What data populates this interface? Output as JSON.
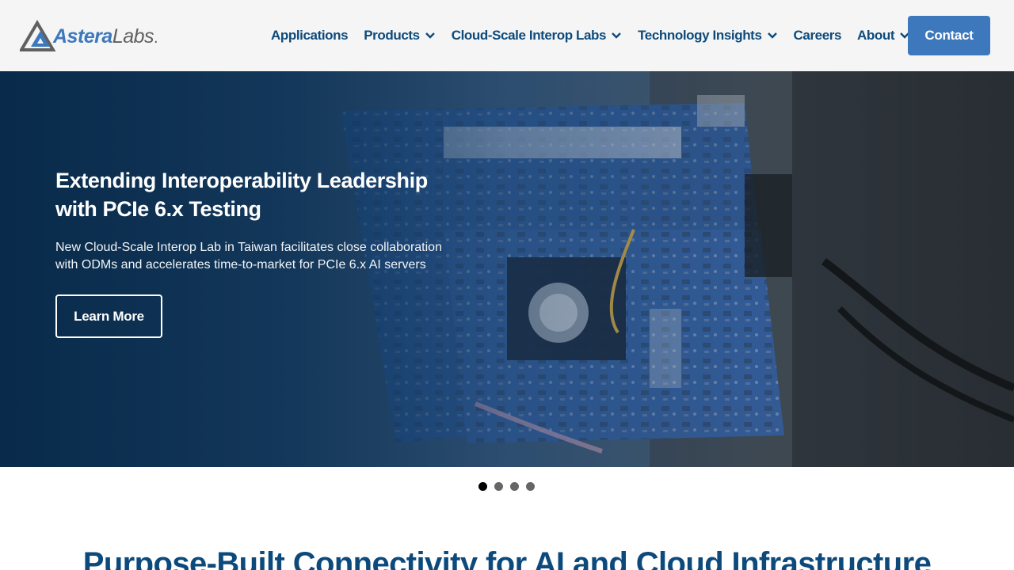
{
  "brand": {
    "logo_part1": "Astera",
    "logo_part2": "Labs",
    "logo_dot": ".",
    "colors": {
      "primary": "#3d78bd",
      "nav_text": "#0d4a7c",
      "logo_gray": "#5f6062"
    }
  },
  "nav": {
    "items": [
      {
        "label": "Applications",
        "dropdown": false
      },
      {
        "label": "Products",
        "dropdown": true
      },
      {
        "label": "Cloud-Scale Interop Labs",
        "dropdown": true
      },
      {
        "label": "Technology Insights",
        "dropdown": true
      },
      {
        "label": "Careers",
        "dropdown": false
      },
      {
        "label": "About",
        "dropdown": true
      }
    ],
    "contact_label": "Contact",
    "chevron_icon": "chevron-down-icon"
  },
  "hero": {
    "title": "Extending Interoperability Leadership with PCIe 6.x Testing",
    "subtitle": "New Cloud-Scale Interop Lab in Taiwan facilitates close collaboration with ODMs and accelerates time-to-market for PCIe 6.x AI servers",
    "button_label": "Learn More",
    "slide_count": 4,
    "active_slide": 1
  },
  "section": {
    "title": "Purpose-Built Connectivity for AI and Cloud Infrastructure"
  }
}
